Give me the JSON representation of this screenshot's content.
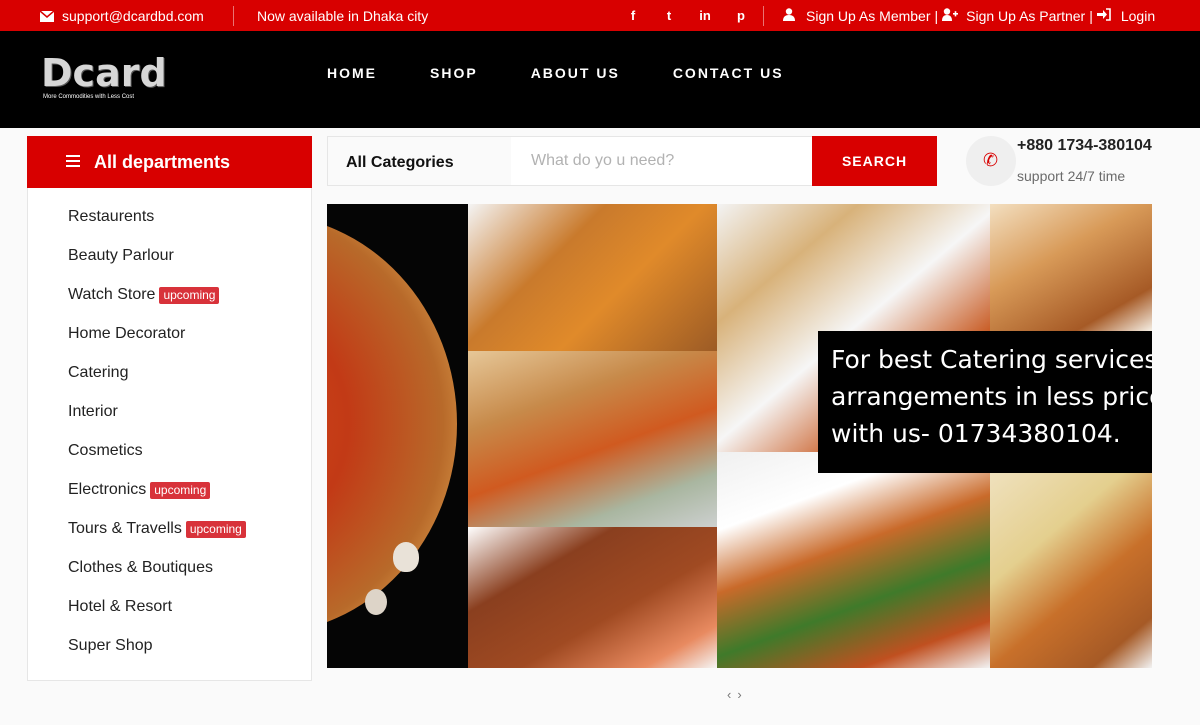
{
  "topbar": {
    "email": "support@dcardbd.com",
    "availability": "Now available in Dhaka city",
    "social": [
      {
        "icon": "facebook-icon",
        "glyph": "f"
      },
      {
        "icon": "twitter-icon",
        "glyph": "t"
      },
      {
        "icon": "linkedin-icon",
        "glyph": "in"
      },
      {
        "icon": "pinterest-icon",
        "glyph": "p"
      }
    ],
    "signup_member": "Sign Up As Member",
    "signup_partner": "Sign Up As Partner",
    "login": "Login",
    "divider": "|"
  },
  "header": {
    "logo_word": "Dcard",
    "logo_tagline": "More Commodities with Less Cost",
    "nav": [
      "HOME",
      "SHOP",
      "ABOUT US",
      "CONTACT US"
    ]
  },
  "departments": {
    "title": "All departments",
    "items": [
      {
        "label": "Restaurents",
        "badge": ""
      },
      {
        "label": "Beauty Parlour",
        "badge": ""
      },
      {
        "label": "Watch Store",
        "badge": "upcoming"
      },
      {
        "label": "Home Decorator",
        "badge": ""
      },
      {
        "label": "Catering",
        "badge": ""
      },
      {
        "label": "Interior",
        "badge": ""
      },
      {
        "label": "Cosmetics",
        "badge": ""
      },
      {
        "label": "Electronics",
        "badge": "upcoming"
      },
      {
        "label": "Tours & Travells",
        "badge": "upcoming"
      },
      {
        "label": "Clothes & Boutiques",
        "badge": ""
      },
      {
        "label": "Hotel & Resort",
        "badge": ""
      },
      {
        "label": "Super Shop",
        "badge": ""
      }
    ]
  },
  "search": {
    "category": "All Categories",
    "placeholder": "What do yo u need?",
    "value": "",
    "button": "SEARCH"
  },
  "contact": {
    "phone": "+880 1734-380104",
    "support": "support 24/7 time"
  },
  "banner": {
    "caption_lines": [
      "For best Catering services",
      "arrangements in less price",
      "with us- 01734380104."
    ],
    "prev": "‹",
    "next": "›"
  },
  "colors": {
    "accent": "#d80000",
    "header_bg": "#000000",
    "badge": "#d8323a"
  }
}
